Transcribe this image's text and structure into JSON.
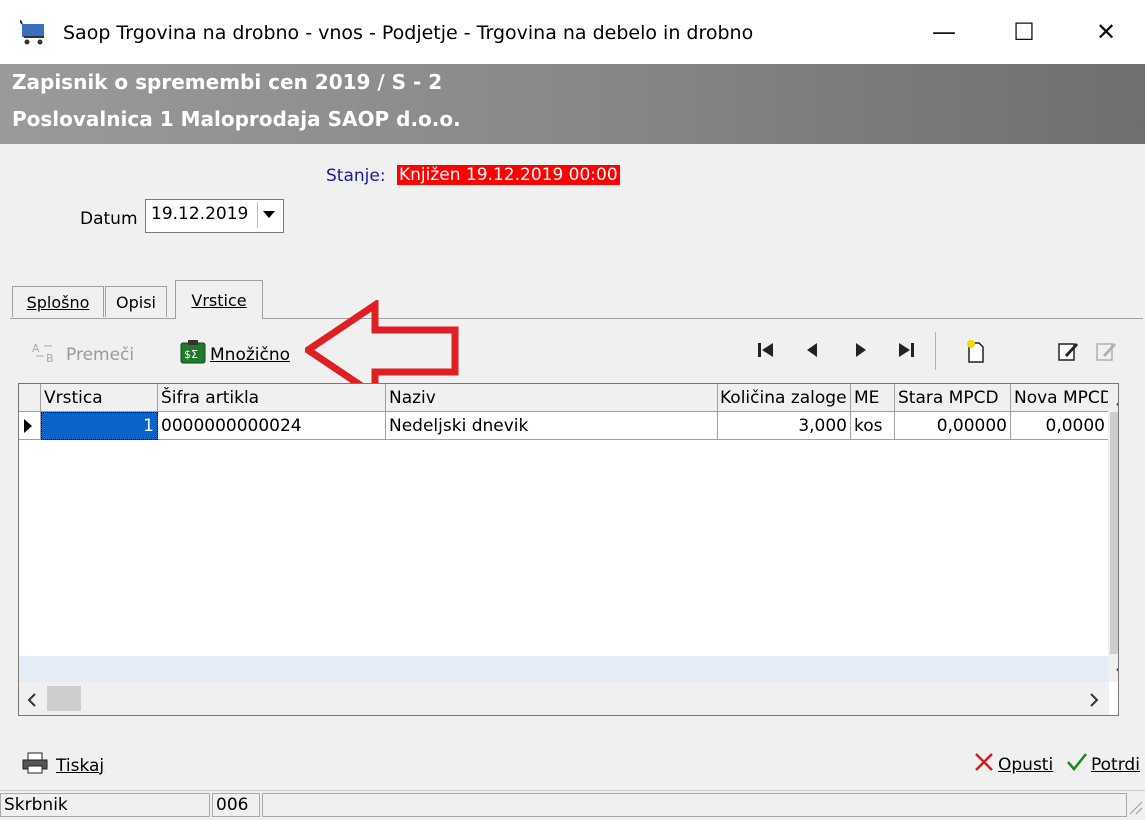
{
  "window": {
    "title": "Saop Trgovina na drobno - vnos - Podjetje - Trgovina na debelo in drobno",
    "minimize": "—",
    "maximize": "☐",
    "close": "✕"
  },
  "header": {
    "line1": "Zapisnik o spremembi cen 2019 / S - 2",
    "line2": "Poslovalnica 1 Maloprodaja SAOP d.o.o."
  },
  "status": {
    "label": "Stanje:",
    "value": "Knjižen 19.12.2019 00:00"
  },
  "date": {
    "label": "Datum",
    "value": "19.12.2019"
  },
  "tabs": [
    {
      "label": "Splošno"
    },
    {
      "label": "Opisi"
    },
    {
      "label": "Vrstice"
    }
  ],
  "toolbar": {
    "premeci_label": "Premeči",
    "mnozicno_label": "Množično"
  },
  "grid": {
    "columns": [
      "Vrstica",
      "Šifra artikla",
      "Naziv",
      "Količina zaloge",
      "ME",
      "Stara MPCD",
      "Nova MPCD"
    ],
    "rows": [
      {
        "vrstica": "1",
        "sifra": "0000000000024",
        "naziv": "Nedeljski dnevik",
        "kolicina": "3,000",
        "me": "kos",
        "stara": "0,00000",
        "nova": "0,0000"
      }
    ]
  },
  "footer": {
    "print_label": "Tiskaj",
    "cancel_label": "Opusti",
    "confirm_label": "Potrdi"
  },
  "statusbar": {
    "user_label": "Skrbnik",
    "user_value": "006"
  },
  "colors": {
    "status_bg": "#ff0000",
    "status_label": "#1a1aa0",
    "annotation_arrow": "#e02020",
    "selection": "#0a64c8"
  },
  "icons": [
    "cart-icon",
    "swap-icon",
    "calculator-icon",
    "first-record-icon",
    "prev-record-icon",
    "next-record-icon",
    "last-record-icon",
    "new-document-icon",
    "edit-icon",
    "edit-disabled-icon",
    "printer-icon",
    "cancel-x-icon",
    "checkmark-icon"
  ]
}
